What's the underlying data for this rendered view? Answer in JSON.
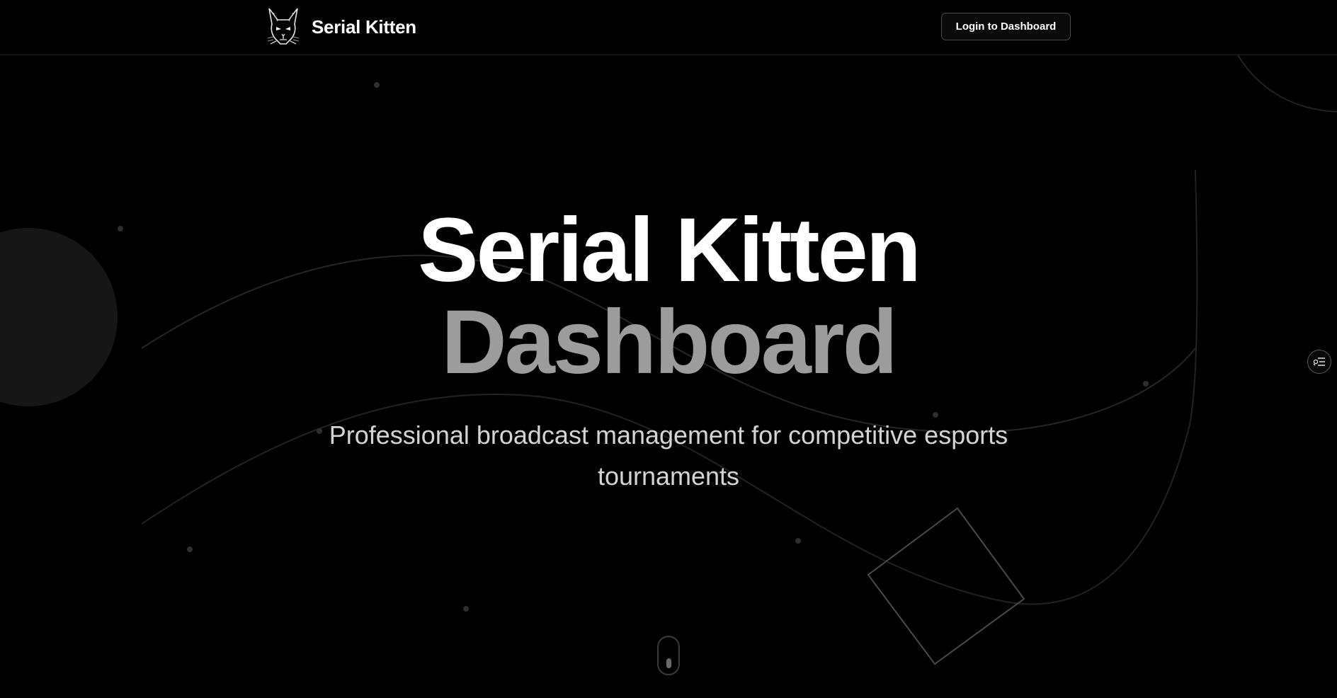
{
  "app": {
    "brand_name": "Serial Kitten",
    "logo_icon": "cat-head-logo-icon"
  },
  "header": {
    "login_label": "Login to Dashboard"
  },
  "hero": {
    "title_line1": "Serial Kitten",
    "title_line2": "Dashboard",
    "subtitle": "Professional broadcast management for competitive esports tournaments"
  },
  "scroll_indicator_icon": "mouse-scroll-icon",
  "side_widget_icon": "settings-list-icon",
  "colors": {
    "background": "#000000",
    "text_primary": "#ffffff",
    "text_secondary": "#9c9c9c",
    "text_subtitle": "#d4d4d4",
    "button_border": "#4a4a4a"
  }
}
